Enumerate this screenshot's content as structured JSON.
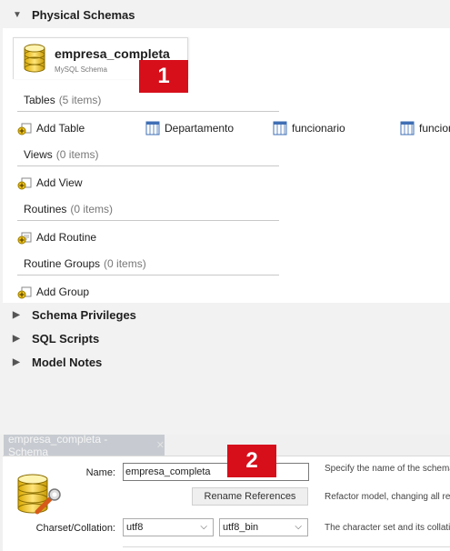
{
  "overview": {
    "physical_schemas_label": "Physical Schemas",
    "schema": {
      "name": "empresa_completa",
      "subtitle": "MySQL Schema"
    },
    "groups": {
      "tables": {
        "label": "Tables",
        "count": "(5 items)",
        "add_label": "Add Table",
        "items": [
          "Departamento",
          "funcionario",
          "funcion"
        ]
      },
      "views": {
        "label": "Views",
        "count": "(0 items)",
        "add_label": "Add View"
      },
      "routines": {
        "label": "Routines",
        "count": "(0 items)",
        "add_label": "Add Routine"
      },
      "routine_groups": {
        "label": "Routine Groups",
        "count": "(0 items)",
        "add_label": "Add Group"
      }
    },
    "collapsed_sections": [
      "Schema Privileges",
      "SQL Scripts",
      "Model Notes"
    ]
  },
  "badges": {
    "one": "1",
    "two": "2"
  },
  "editor": {
    "tab_title": "empresa_completa - Schema",
    "tab_close": "✕",
    "name_label": "Name:",
    "name_value": "empresa_completa",
    "name_desc": "Specify the name of the schema",
    "rename_button": "Rename References",
    "rename_desc": "Refactor model, changing all refer",
    "charset_label": "Charset/Collation:",
    "charset_value": "utf8",
    "collation_value": "utf8_bin",
    "charset_desc": "The character set and its collatio"
  },
  "colors": {
    "badge": "#d60f1b",
    "accent_icon": "#f0c419"
  }
}
